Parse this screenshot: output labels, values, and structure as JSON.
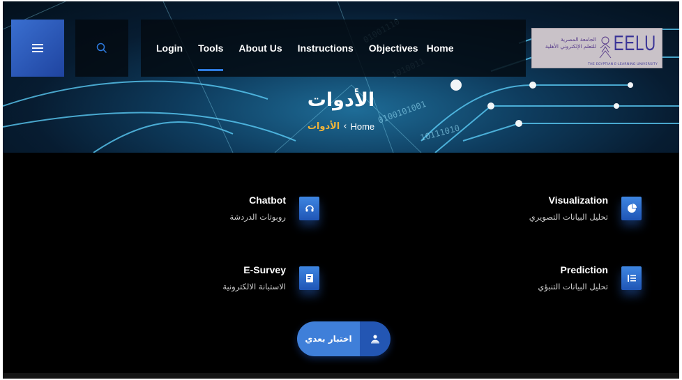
{
  "header": {
    "menu_icon": "hamburger-menu-icon",
    "search_icon": "search-icon",
    "nav_links": [
      "Login",
      "Tools",
      "About Us",
      "Instructions",
      "Objectives",
      "Home"
    ],
    "active_nav": "Tools",
    "logo": {
      "arabic_line1": "الجامعة المصرية",
      "arabic_line2": "للتعلم الإلكتروني الأهلية",
      "abbr": "EELU",
      "english": "THE EGYPTIAN E-LEARNING UNIVERSITY"
    }
  },
  "hero": {
    "title": "الأدوات",
    "breadcrumb": {
      "home": "Home",
      "separator": "‹",
      "current": "الأدوات"
    }
  },
  "tools": [
    {
      "title": "Visualization",
      "subtitle": "تحليل البيانات التصويري",
      "icon": "pie-chart-icon"
    },
    {
      "title": "Chatbot",
      "subtitle": "روبوتات الدردشة",
      "icon": "headset-icon"
    },
    {
      "title": "Prediction",
      "subtitle": "تحليل البيانات التنبؤي",
      "icon": "list-icon"
    },
    {
      "title": "E-Survey",
      "subtitle": "الاستبانة الالكترونية",
      "icon": "document-icon"
    }
  ],
  "cta": {
    "label": "اختبار بعدي",
    "icon": "user-test-icon"
  },
  "colors": {
    "accent": "#3f7fd9",
    "accent_dark": "#2356b3",
    "breadcrumb_current": "#f0b43a",
    "content_bg": "#000000"
  }
}
